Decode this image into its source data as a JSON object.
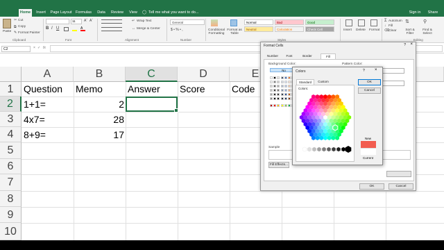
{
  "ribbon_tabs": [
    "Home",
    "Insert",
    "Page Layout",
    "Formulas",
    "Data",
    "Review",
    "View"
  ],
  "tell_me": "Tell me what you want to do...",
  "account": {
    "sign_in": "Sign in",
    "share": "Share"
  },
  "clipboard": {
    "paste": "Paste",
    "cut": "Cut",
    "copy": "Copy",
    "format_painter": "Format Painter",
    "label": "Clipboard"
  },
  "font_group": {
    "font_size": "11",
    "label": "Font"
  },
  "alignment": {
    "wrap_text": "Wrap Text",
    "merge_center": "Merge & Center",
    "label": "Alignment"
  },
  "number": {
    "format": "General",
    "label": "Number"
  },
  "styles": {
    "conditional": "Conditional Formatting",
    "format_as_table": "Format as Table",
    "label": "Styles",
    "cells": [
      {
        "text": "Normal",
        "bg": "#ffffff",
        "fg": "#000000"
      },
      {
        "text": "Bad",
        "bg": "#ffc7ce",
        "fg": "#9c0006"
      },
      {
        "text": "Good",
        "bg": "#c6efce",
        "fg": "#006100"
      },
      {
        "text": "Neutral",
        "bg": "#ffeb9c",
        "fg": "#9c5700"
      },
      {
        "text": "Calculation",
        "bg": "#f2f2f2",
        "fg": "#fa7d00"
      },
      {
        "text": "Check Cell",
        "bg": "#a5a5a5",
        "fg": "#ffffff"
      }
    ]
  },
  "cells_group": {
    "insert": "Insert",
    "delete": "Delete",
    "format": "Format"
  },
  "editing": {
    "autosum": "AutoSum",
    "fill": "Fill",
    "clear": "Clear",
    "sort_filter": "Sort & Filter",
    "find_select": "Find & Select",
    "label": "Editing"
  },
  "name_box": "C2",
  "formula_fx": "fx",
  "columns": [
    "A",
    "B",
    "C",
    "D",
    "E"
  ],
  "rows": [
    "1",
    "2",
    "3",
    "4",
    "5",
    "6",
    "7",
    "8",
    "9",
    "10"
  ],
  "sheet": {
    "headers": [
      "Question",
      "Memo",
      "Answer",
      "Score",
      "Code"
    ],
    "questions": [
      "1+1=",
      "4x7=",
      "8+9="
    ],
    "memos": [
      "2",
      "28",
      "17"
    ]
  },
  "format_cells": {
    "title": "Format Cells",
    "tabs": [
      "Number",
      "Font",
      "Border",
      "Fill"
    ],
    "background_color": "Background Color:",
    "no_color": "No",
    "pattern_color": "Pattern Color:",
    "fill_effects": "Fill Effects...",
    "sample": "Sample",
    "ok": "OK",
    "cancel": "Cancel"
  },
  "colors_dialog": {
    "title": "Colors",
    "help": "?",
    "close": "×",
    "tabs": [
      "Standard",
      "Custom"
    ],
    "colors_label": "Colors:",
    "ok": "OK",
    "cancel": "Cancel",
    "new_label": "New",
    "current_label": "Current",
    "new_color": "#f25c4f",
    "current_color": "#ffffff",
    "accent": "#217346"
  }
}
